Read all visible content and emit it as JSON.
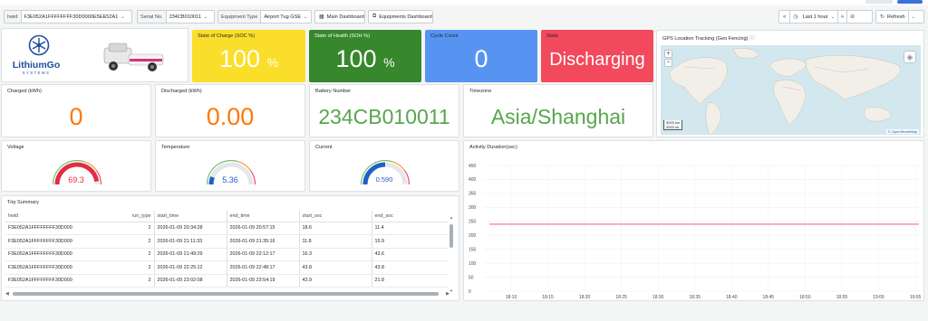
{
  "toolbar": {
    "vars": [
      {
        "label": "hwid",
        "value": "F3E052A1FFFFFFFF30D0000E5EE52A1"
      },
      {
        "label": "Serial No.",
        "value": "234CB010011"
      },
      {
        "label": "Equipment Type",
        "value": "Airport Tug GSE"
      }
    ],
    "main_dashboard": "Main Dashboard",
    "equipments_dashboard": "Equipments Dashboard",
    "time_range": "Last 1 hour",
    "refresh": "Refresh"
  },
  "logo": {
    "brand_text": "LithiumGo",
    "brand_sub": "SYSTEMS"
  },
  "stats": {
    "soc": {
      "title": "State of Charge (SOC %)",
      "value": "100",
      "unit": "%",
      "color": "#fade2a"
    },
    "soh": {
      "title": "State of Health (SOH %)",
      "value": "100",
      "unit": "%",
      "color": "#37872d"
    },
    "cycle": {
      "title": "Cycle Count",
      "value": "0",
      "color": "#5794f2"
    },
    "state": {
      "title": "State",
      "value": "Discharging",
      "color": "#f2495c"
    },
    "charged": {
      "title": "Charged (kWh)",
      "value": "0",
      "color": "#ff780a"
    },
    "discharged": {
      "title": "Discharged (kWh)",
      "value": "0.00",
      "color": "#ff780a"
    },
    "battery": {
      "title": "Battery Number",
      "value": "234CB010011",
      "color": "#56a64b"
    },
    "timezone": {
      "title": "Timezone",
      "value": "Asia/Shanghai",
      "color": "#56a64b"
    }
  },
  "gauges": {
    "voltage": {
      "title": "Voltage",
      "value": "69.3",
      "color": "#e02f44",
      "fraction": 0.95
    },
    "temperature": {
      "title": "Temperature",
      "value": "5.36",
      "color": "#1f60c4",
      "fraction": 0.12
    },
    "current": {
      "title": "Current",
      "value": "0.590",
      "color": "#1f60c4",
      "fraction": 0.5
    }
  },
  "map": {
    "title": "GPS Location Tracking (Geo Fencing)",
    "zoom_in": "+",
    "zoom_out": "−",
    "scale_km": "3000 km",
    "scale_mi": "3000 mi",
    "attribution": "© OpenStreetMap"
  },
  "trips": {
    "title": "Trip Summary",
    "columns": [
      "hwid",
      "run_type",
      "start_time",
      "end_time",
      "start_soc",
      "end_soc"
    ],
    "rows": [
      [
        "F3E052A1FFFFFFFF30D000",
        "2",
        "2026-01-09 20:34:28",
        "2026-01-09 20:57:15",
        "18.6",
        "11.4"
      ],
      [
        "F3E052A1FFFFFFFF30D000",
        "2",
        "2026-01-09 21:11:33",
        "2026-01-09 21:35:16",
        "11.8",
        "15.9"
      ],
      [
        "F3E052A1FFFFFFFF30D000",
        "2",
        "2026-01-09 21:49:29",
        "2026-01-09 22:12:17",
        "16.3",
        "43.6"
      ],
      [
        "F3E052A1FFFFFFFF30D000",
        "2",
        "2026-01-09 22:25:12",
        "2026-01-09 22:48:17",
        "43.8",
        "43.8"
      ],
      [
        "F3E052A1FFFFFFFF30D000",
        "2",
        "2026-01-09 23:02:08",
        "2026-01-09 23:54:19",
        "43.9",
        "21.8"
      ]
    ]
  },
  "chart_data": {
    "type": "line",
    "title": "Activity Duration(sec)",
    "x": [
      "18:10",
      "18:15",
      "18:20",
      "18:25",
      "18:30",
      "18:35",
      "18:40",
      "18:45",
      "18:50",
      "18:55",
      "19:00",
      "19:05"
    ],
    "series": [
      {
        "values": [
          240,
          240,
          240,
          240,
          240,
          240,
          240,
          240,
          240,
          240,
          240,
          240
        ],
        "color": "#f2495c"
      }
    ],
    "yticks": [
      "450",
      "400",
      "350",
      "300",
      "250",
      "200",
      "150",
      "100",
      "50",
      "0"
    ],
    "ylim": [
      0,
      450
    ],
    "grid": true
  }
}
